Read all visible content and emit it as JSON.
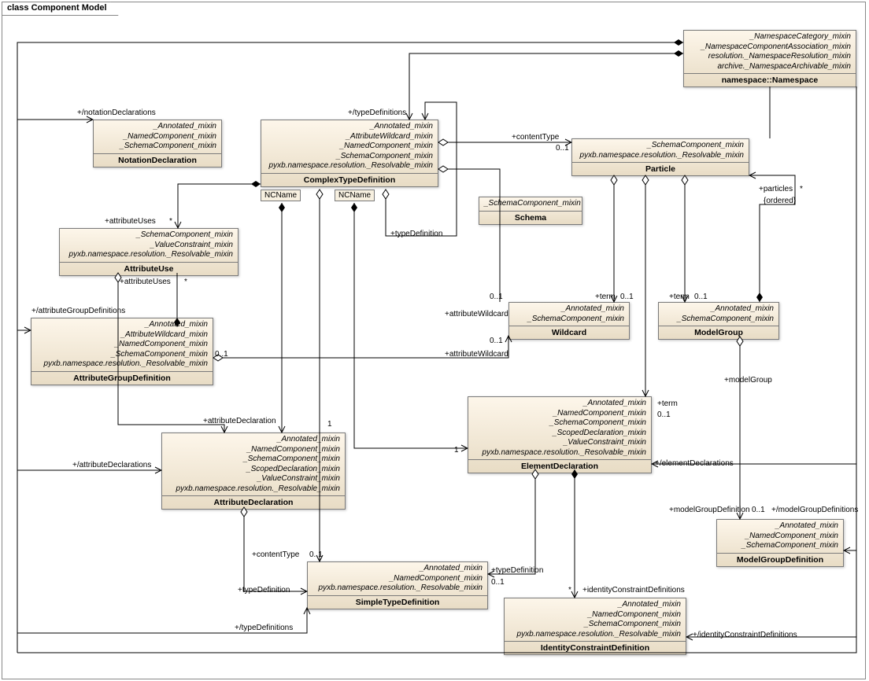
{
  "frame": {
    "title": "class Component Model"
  },
  "classes": {
    "namespace": {
      "mixins": [
        "_NamespaceCategory_mixin",
        "_NamespaceComponentAssociation_mixin",
        "resolution._NamespaceResolution_mixin",
        "archive._NamespaceArchivable_mixin"
      ],
      "name": "namespace::Namespace"
    },
    "notation": {
      "mixins": [
        "_Annotated_mixin",
        "_NamedComponent_mixin",
        "_SchemaComponent_mixin"
      ],
      "name": "NotationDeclaration"
    },
    "complexType": {
      "mixins": [
        "_Annotated_mixin",
        "_AttributeWildcard_mixin",
        "_NamedComponent_mixin",
        "_SchemaComponent_mixin",
        "pyxb.namespace.resolution._Resolvable_mixin"
      ],
      "name": "ComplexTypeDefinition"
    },
    "particle": {
      "mixins": [
        "_SchemaComponent_mixin",
        "pyxb.namespace.resolution._Resolvable_mixin"
      ],
      "name": "Particle"
    },
    "schema": {
      "mixins": [
        "_SchemaComponent_mixin"
      ],
      "name": "Schema"
    },
    "attributeUse": {
      "mixins": [
        "_SchemaComponent_mixin",
        "_ValueConstraint_mixin",
        "pyxb.namespace.resolution._Resolvable_mixin"
      ],
      "name": "AttributeUse"
    },
    "wildcard": {
      "mixins": [
        "_Annotated_mixin",
        "_SchemaComponent_mixin"
      ],
      "name": "Wildcard"
    },
    "modelGroup": {
      "mixins": [
        "_Annotated_mixin",
        "_SchemaComponent_mixin"
      ],
      "name": "ModelGroup"
    },
    "attrGroupDef": {
      "mixins": [
        "_Annotated_mixin",
        "_AttributeWildcard_mixin",
        "_NamedComponent_mixin",
        "_SchemaComponent_mixin",
        "pyxb.namespace.resolution._Resolvable_mixin"
      ],
      "name": "AttributeGroupDefinition"
    },
    "elementDecl": {
      "mixins": [
        "_Annotated_mixin",
        "_NamedComponent_mixin",
        "_SchemaComponent_mixin",
        "_ScopedDeclaration_mixin",
        "_ValueConstraint_mixin",
        "pyxb.namespace.resolution._Resolvable_mixin"
      ],
      "name": "ElementDeclaration"
    },
    "attrDecl": {
      "mixins": [
        "_Annotated_mixin",
        "_NamedComponent_mixin",
        "_SchemaComponent_mixin",
        "_ScopedDeclaration_mixin",
        "_ValueConstraint_mixin",
        "pyxb.namespace.resolution._Resolvable_mixin"
      ],
      "name": "AttributeDeclaration"
    },
    "modelGroupDef": {
      "mixins": [
        "_Annotated_mixin",
        "_NamedComponent_mixin",
        "_SchemaComponent_mixin"
      ],
      "name": "ModelGroupDefinition"
    },
    "simpleType": {
      "mixins": [
        "_Annotated_mixin",
        "_NamedComponent_mixin",
        "pyxb.namespace.resolution._Resolvable_mixin"
      ],
      "name": "SimpleTypeDefinition"
    },
    "idConstraint": {
      "mixins": [
        "_Annotated_mixin",
        "_NamedComponent_mixin",
        "_SchemaComponent_mixin",
        "pyxb.namespace.resolution._Resolvable_mixin"
      ],
      "name": "IdentityConstraintDefinition"
    }
  },
  "qualifiers": {
    "ncname1": "NCName",
    "ncname2": "NCName"
  },
  "labels": {
    "notationDecls": "+/notationDeclarations",
    "typeDefs": "+/typeDefinitions",
    "contentType": "+contentType",
    "zero_one": "0..1",
    "star": "*",
    "attributeUses": "+attributeUses",
    "typeDefinition": "+typeDefinition",
    "attributeGroupDefs": "+/attributeGroupDefinitions",
    "attributeWildcard": "+attributeWildcard",
    "term": "+term",
    "particles": "+particles",
    "ordered": "{ordered}",
    "modelGroup": "+modelGroup",
    "elementDecls": "+/elementDeclarations",
    "attrDecl": "+attributeDeclaration",
    "one": "1",
    "attrDecls": "+/attributeDeclarations",
    "modelGroupDef": "+modelGroupDefinition",
    "modelGroupDefs": "+/modelGroupDefinitions",
    "idConstraintDefs": "+identityConstraintDefinitions",
    "idConstraintDefs2": "+/identityConstraintDefinitions",
    "typeDefs2": "+/typeDefinitions"
  }
}
